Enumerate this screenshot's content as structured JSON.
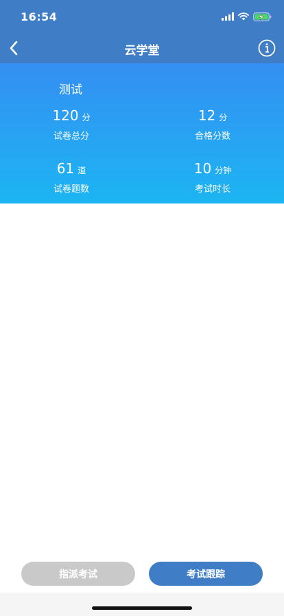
{
  "status_bar": {
    "time": "16:54"
  },
  "navbar": {
    "title": "云学堂",
    "back_icon": "chevron-left-icon",
    "info_icon": "info-circle-icon"
  },
  "exam": {
    "name": "测试",
    "stats": [
      {
        "value": "120",
        "unit": "分",
        "caption": "试卷总分"
      },
      {
        "value": "12",
        "unit": "分",
        "caption": "合格分数"
      },
      {
        "value": "61",
        "unit": "道",
        "caption": "试卷题数"
      },
      {
        "value": "10",
        "unit": "分钟",
        "caption": "考试时长"
      }
    ]
  },
  "actions": {
    "assign_label": "指派考试",
    "track_label": "考试跟踪"
  },
  "colors": {
    "header": "#3f7ec7",
    "gradient_top": "#348ff2",
    "gradient_bottom": "#1cb5f2",
    "button_disabled": "#c9c9c9",
    "button_primary": "#3f7ec7"
  }
}
